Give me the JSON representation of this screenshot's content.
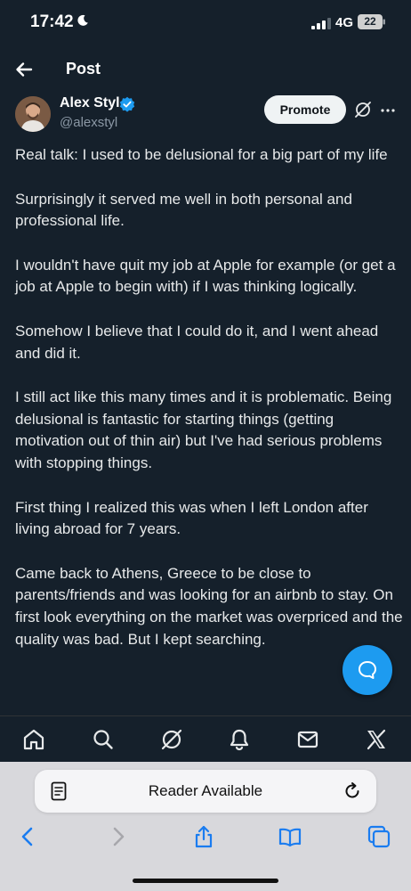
{
  "status_bar": {
    "time": "17:42",
    "network": "4G",
    "battery": "22"
  },
  "nav": {
    "title": "Post"
  },
  "author": {
    "name": "Alex Styl",
    "handle": "@alexstyl",
    "promote_label": "Promote"
  },
  "post": {
    "paragraphs": [
      "Real talk: I used to be delusional for a big part of my life",
      "Surprisingly it served me well in both personal and professional life.",
      "I wouldn't have quit my job at Apple for example (or get a job at Apple to begin with) if I was thinking logically.",
      "Somehow I believe that I could do it, and I went ahead and did it.",
      "I still act like this many times and it is problematic. Being delusional is fantastic for starting things (getting motivation out of thin air) but I've had serious problems with stopping things.",
      "First thing I realized this was when I left London after living abroad for 7 years.",
      "Came back to Athens, Greece to be close to parents/friends and was looking for an airbnb to stay. On first look everything on the market was overpriced and the quality was bad. But I kept searching."
    ]
  },
  "bottom_nav": {
    "tabs": [
      "home-icon",
      "search-icon",
      "grok-icon",
      "notifications-icon",
      "messages-icon",
      "x-logo-icon"
    ]
  },
  "safari": {
    "reader_label": "Reader Available"
  },
  "colors": {
    "background": "#15202b",
    "accent": "#1d9bf0",
    "text": "#e7e9ea",
    "secondary_text": "#8b98a5"
  }
}
